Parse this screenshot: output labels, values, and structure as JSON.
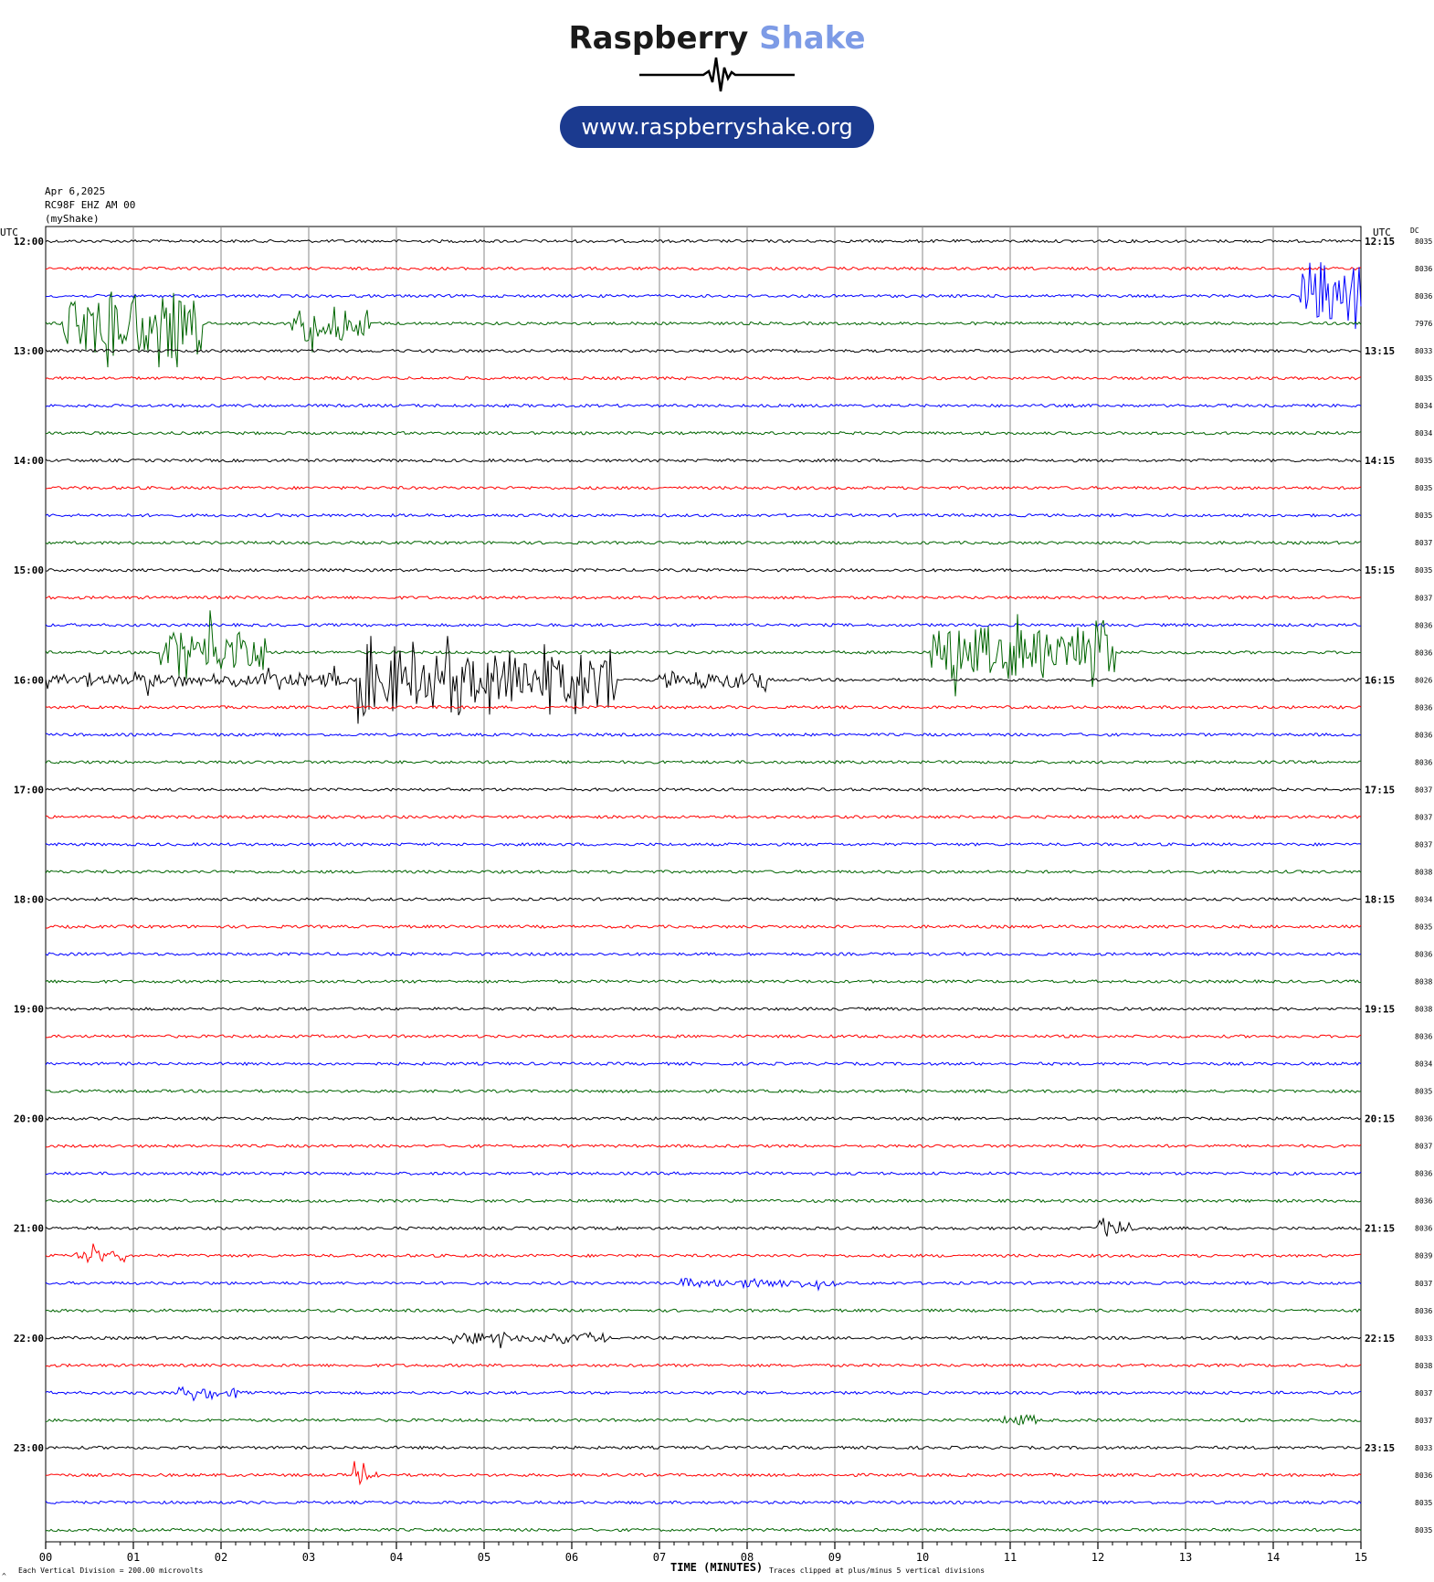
{
  "brand": {
    "name": "Raspberry",
    "accent": "Shake",
    "url": "www.raspberryshake.org",
    "accent_color": "#7d9be6",
    "pill_color": "#1b3a8f"
  },
  "header": {
    "date": "Apr 6,2025",
    "station": "RC98F EHZ AM 00",
    "network": "(myShake)"
  },
  "labels": {
    "utc_left": "UTC",
    "utc_right": "UTC",
    "dc": "DC",
    "xlabel": "TIME (MINUTES)",
    "footer_left": "Each Vertical Division =  200.00 microvolts",
    "footer_right": "Traces clipped at plus/minus 5 vertical divisions",
    "corner": "^"
  },
  "chart_data": {
    "type": "line",
    "title": "",
    "xlabel": "TIME (MINUTES)",
    "xlim": [
      0,
      15
    ],
    "x_ticks": [
      "00",
      "01",
      "02",
      "03",
      "04",
      "05",
      "06",
      "07",
      "08",
      "09",
      "10",
      "11",
      "12",
      "13",
      "14",
      "15"
    ],
    "trace_colors": [
      "#000000",
      "#ff0000",
      "#0000ff",
      "#006400"
    ],
    "hour_labels_left": [
      "12:00",
      "13:00",
      "14:00",
      "15:00",
      "16:00",
      "17:00",
      "18:00",
      "19:00",
      "20:00",
      "21:00",
      "22:00",
      "23:00"
    ],
    "hour_labels_right": [
      "12:15",
      "13:15",
      "14:15",
      "15:15",
      "16:15",
      "17:15",
      "18:15",
      "19:15",
      "20:15",
      "21:15",
      "22:15",
      "23:15"
    ],
    "dc_offsets": [
      "8035",
      "8036",
      "8036",
      "7976",
      "8033",
      "8035",
      "8034",
      "8034",
      "8035",
      "8035",
      "8035",
      "8037",
      "8035",
      "8037",
      "8036",
      "8036",
      "8026",
      "8036",
      "8036",
      "8036",
      "8037",
      "8037",
      "8037",
      "8038",
      "8034",
      "8035",
      "8036",
      "8038",
      "8038",
      "8036",
      "8034",
      "8035",
      "8036",
      "8037",
      "8036",
      "8036",
      "8036",
      "8039",
      "8037",
      "8036",
      "8033",
      "8038",
      "8037",
      "8037",
      "8033",
      "8036",
      "8035",
      "8035"
    ],
    "events": [
      {
        "trace": 3,
        "start": 0.2,
        "end": 1.8,
        "amp": 5
      },
      {
        "trace": 3,
        "start": 2.8,
        "end": 3.7,
        "amp": 2.5
      },
      {
        "trace": 2,
        "start": 14.3,
        "end": 15.0,
        "amp": 5
      },
      {
        "trace": 15,
        "start": 1.3,
        "end": 2.5,
        "amp": 4
      },
      {
        "trace": 15,
        "start": 10.1,
        "end": 12.2,
        "amp": 4
      },
      {
        "trace": 16,
        "start": 0.0,
        "end": 3.5,
        "amp": 1
      },
      {
        "trace": 16,
        "start": 3.5,
        "end": 6.5,
        "amp": 5
      },
      {
        "trace": 16,
        "start": 7.0,
        "end": 8.25,
        "amp": 1.2
      },
      {
        "trace": 36,
        "start": 12.0,
        "end": 12.4,
        "amp": 1.5
      },
      {
        "trace": 37,
        "start": 0.3,
        "end": 0.9,
        "amp": 1
      },
      {
        "trace": 38,
        "start": 7.2,
        "end": 9.0,
        "amp": 0.7
      },
      {
        "trace": 40,
        "start": 4.6,
        "end": 6.4,
        "amp": 0.8
      },
      {
        "trace": 42,
        "start": 1.5,
        "end": 2.2,
        "amp": 0.8
      },
      {
        "trace": 43,
        "start": 10.9,
        "end": 11.3,
        "amp": 0.8
      },
      {
        "trace": 45,
        "start": 3.5,
        "end": 3.8,
        "amp": 0.9
      }
    ]
  }
}
